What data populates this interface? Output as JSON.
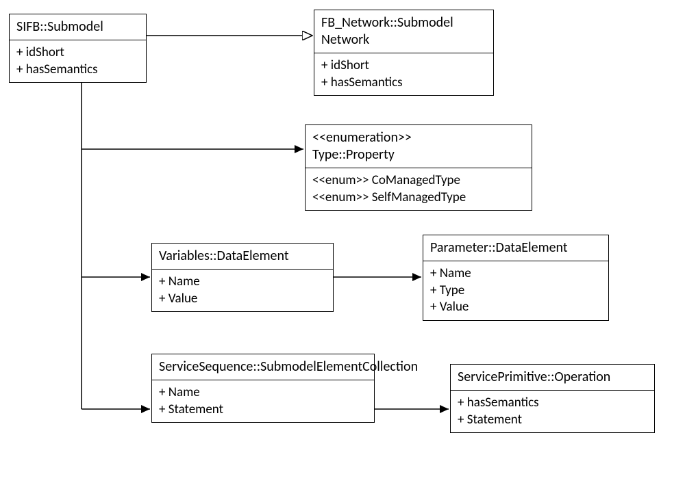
{
  "boxes": {
    "sifb": {
      "title": "SIFB::Submodel",
      "attrs": [
        "+ idShort",
        "+ hasSemantics"
      ]
    },
    "fbnet": {
      "title": "FB_Network::Submodel Network",
      "attrs": [
        "+ idShort",
        "+ hasSemantics"
      ]
    },
    "type": {
      "stereotype": "<<enumeration>>",
      "title": "Type::Property",
      "attrs": [
        "<<enum>> CoManagedType",
        "<<enum>> SelfManagedType"
      ]
    },
    "vars": {
      "title": "Variables::DataElement",
      "attrs": [
        "+ Name",
        "+ Value"
      ]
    },
    "param": {
      "title": "Parameter::DataElement",
      "attrs": [
        "+ Name",
        "+ Type",
        "+ Value"
      ]
    },
    "seq": {
      "title": "ServiceSequence::SubmodelElementCollection",
      "attrs": [
        "+ Name",
        "+ Statement"
      ]
    },
    "prim": {
      "title": "ServicePrimitive::Operation",
      "attrs": [
        "+ hasSemantics",
        "+ Statement"
      ]
    }
  }
}
